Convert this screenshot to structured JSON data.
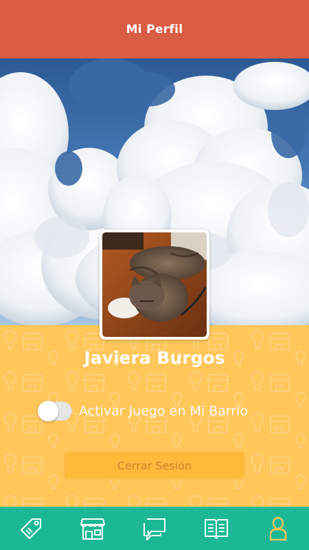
{
  "header": {
    "title": "Mi Perfil"
  },
  "profile": {
    "name": "Javiera Burgos",
    "avatar_description": "cat-photo"
  },
  "settings": {
    "toggle_label": "Activar Juego en Mi Barrio",
    "toggle_on": false
  },
  "actions": {
    "logout_label": "Cerrar Sesión"
  },
  "tabbar": {
    "items": [
      {
        "icon": "tag-icon"
      },
      {
        "icon": "store-icon"
      },
      {
        "icon": "chat-icon"
      },
      {
        "icon": "book-icon"
      },
      {
        "icon": "user-icon",
        "active": true
      }
    ]
  },
  "colors": {
    "header": "#d95c44",
    "background": "#ffc65a",
    "tabbar": "#1cb896",
    "active_tab_icon": "#ffc65a",
    "logout_button": "#ffb93b"
  }
}
